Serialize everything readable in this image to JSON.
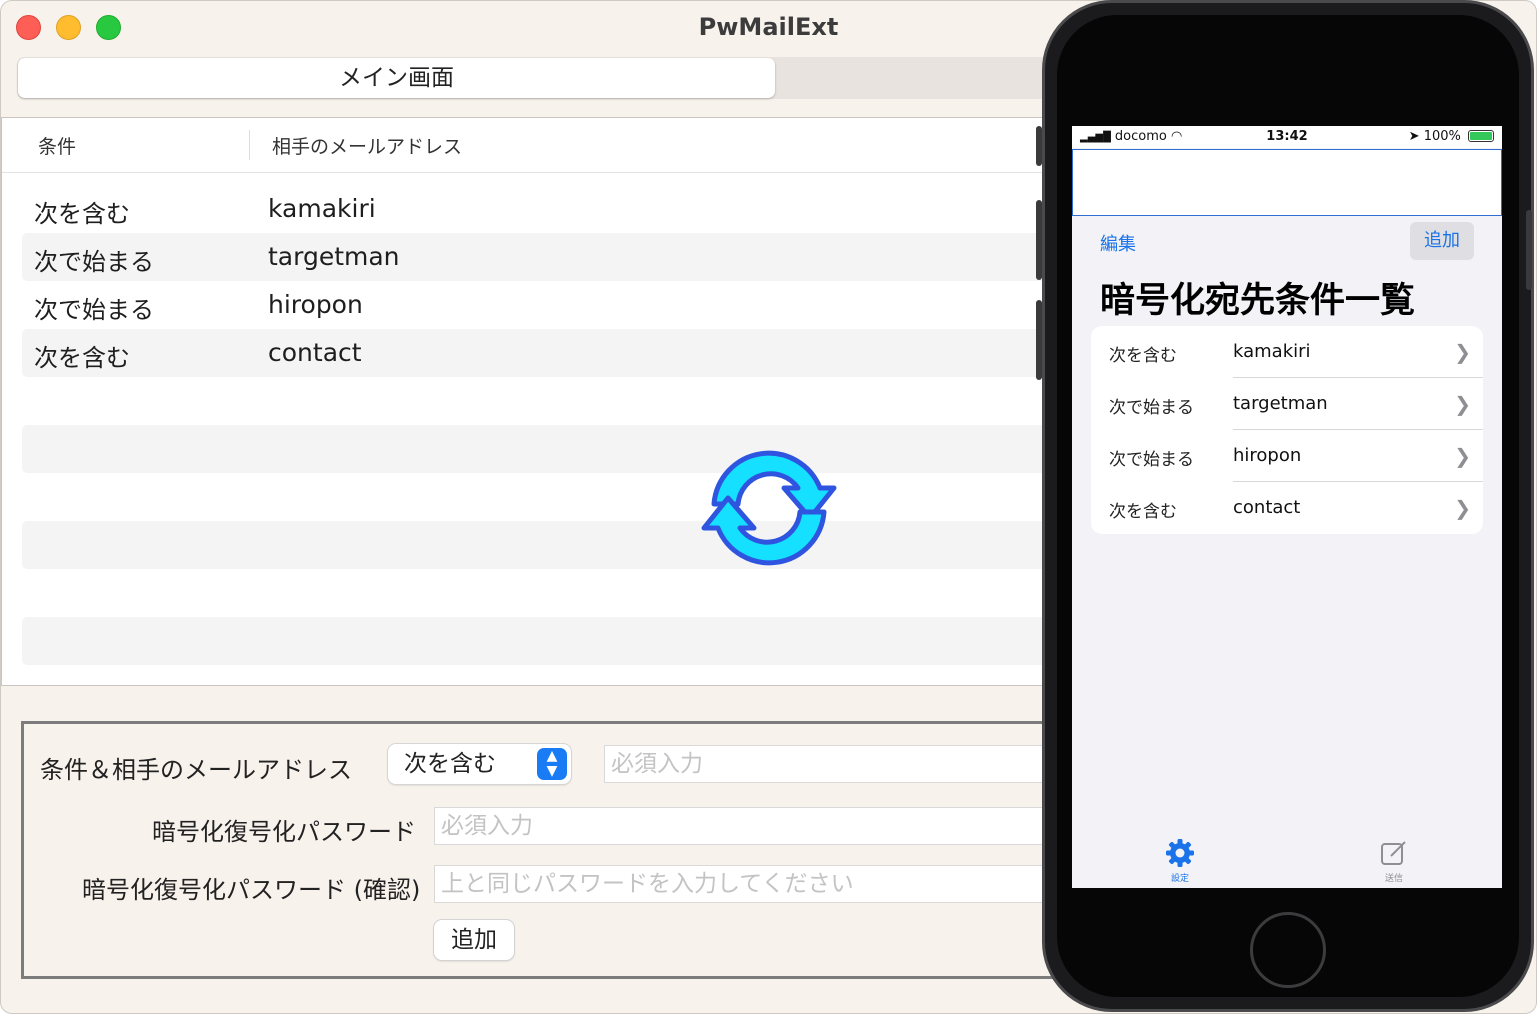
{
  "window": {
    "title": "PwMailExt",
    "tab_label": "メイン画面"
  },
  "table": {
    "headers": {
      "condition": "条件",
      "address": "相手のメールアドレス"
    },
    "rows": [
      {
        "condition": "次を含む",
        "address": "kamakiri"
      },
      {
        "condition": "次で始まる",
        "address": "targetman"
      },
      {
        "condition": "次で始まる",
        "address": "hiropon"
      },
      {
        "condition": "次を含む",
        "address": "contact"
      }
    ]
  },
  "form": {
    "label_condition": "条件＆相手のメールアドレス",
    "select_value": "次を含む",
    "address_placeholder": "必須入力",
    "label_password": "暗号化復号化パスワード",
    "password_placeholder": "必須入力",
    "label_password_confirm": "暗号化復号化パスワード (確認)",
    "password_confirm_placeholder": "上と同じパスワードを入力してください",
    "add_button": "追加"
  },
  "sync_icon": "sync-icon",
  "phone": {
    "status": {
      "carrier": "docomo",
      "time": "13:42",
      "battery": "100%"
    },
    "nav": {
      "edit": "編集",
      "add": "追加",
      "title": "暗号化宛先条件一覧"
    },
    "list": [
      {
        "condition": "次を含む",
        "address": "kamakiri"
      },
      {
        "condition": "次で始まる",
        "address": "targetman"
      },
      {
        "condition": "次で始まる",
        "address": "hiropon"
      },
      {
        "condition": "次を含む",
        "address": "contact"
      }
    ],
    "tabs": [
      {
        "label": "設定",
        "icon": "gear-icon"
      },
      {
        "label": "送信",
        "icon": "compose-icon"
      }
    ]
  },
  "colors": {
    "accent": "#1a73e8",
    "sync_fill": "#16e0ff",
    "sync_stroke": "#2f55e0"
  }
}
